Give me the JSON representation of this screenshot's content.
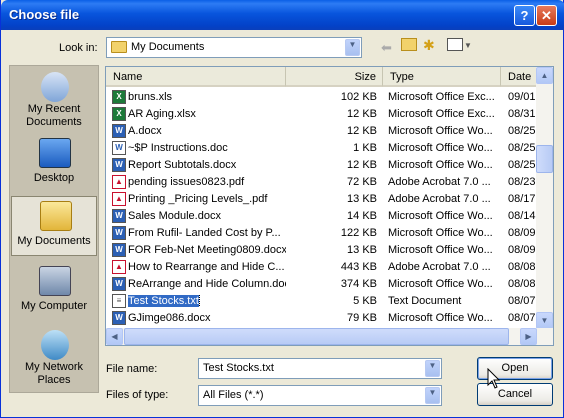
{
  "window": {
    "title": "Choose file",
    "help_label": "?",
    "close_label": "✕"
  },
  "lookin": {
    "label": "Look in:",
    "value": "My Documents"
  },
  "toolbar": {
    "back_icon": "back-arrow-icon",
    "up_icon": "up-folder-icon",
    "new_icon": "new-folder-icon",
    "views_icon": "views-menu-icon"
  },
  "places": [
    {
      "label": "My Recent Documents",
      "icon": "recent-documents-icon"
    },
    {
      "label": "Desktop",
      "icon": "desktop-icon"
    },
    {
      "label": "My Documents",
      "icon": "my-documents-icon"
    },
    {
      "label": "My Computer",
      "icon": "my-computer-icon"
    },
    {
      "label": "My Network Places",
      "icon": "network-places-icon"
    }
  ],
  "columns": [
    "Name",
    "Size",
    "Type",
    "Date"
  ],
  "files": [
    {
      "name": "bruns.xls",
      "size": "102 KB",
      "type": "Microsoft Office Exc...",
      "date": "09/01",
      "kind": "excel"
    },
    {
      "name": "AR Aging.xlsx",
      "size": "12 KB",
      "type": "Microsoft Office Exc...",
      "date": "08/31",
      "kind": "excel"
    },
    {
      "name": "A.docx",
      "size": "12 KB",
      "type": "Microsoft Office Wo...",
      "date": "08/25",
      "kind": "word"
    },
    {
      "name": "~$P Instructions.doc",
      "size": "1 KB",
      "type": "Microsoft Office Wo...",
      "date": "08/25",
      "kind": "doc-temp"
    },
    {
      "name": "Report Subtotals.docx",
      "size": "12 KB",
      "type": "Microsoft Office Wo...",
      "date": "08/25",
      "kind": "word"
    },
    {
      "name": "pending issues0823.pdf",
      "size": "72 KB",
      "type": "Adobe Acrobat 7.0 ...",
      "date": "08/23",
      "kind": "pdf"
    },
    {
      "name": "Printing _Pricing Levels_.pdf",
      "size": "13 KB",
      "type": "Adobe Acrobat 7.0 ...",
      "date": "08/17",
      "kind": "pdf"
    },
    {
      "name": "Sales Module.docx",
      "size": "14 KB",
      "type": "Microsoft Office Wo...",
      "date": "08/14",
      "kind": "word"
    },
    {
      "name": "From Rufil- Landed Cost by P...",
      "size": "122 KB",
      "type": "Microsoft Office Wo...",
      "date": "08/09",
      "kind": "word"
    },
    {
      "name": "FOR Feb-Net Meeting0809.docx",
      "size": "13 KB",
      "type": "Microsoft Office Wo...",
      "date": "08/09",
      "kind": "word"
    },
    {
      "name": "How to Rearrange and Hide C...",
      "size": "443 KB",
      "type": "Adobe Acrobat 7.0 ...",
      "date": "08/08",
      "kind": "pdf"
    },
    {
      "name": "ReArrange and Hide Column.doc",
      "size": "374 KB",
      "type": "Microsoft Office Wo...",
      "date": "08/08",
      "kind": "word"
    },
    {
      "name": "Test Stocks.txt",
      "size": "5 KB",
      "type": "Text Document",
      "date": "08/07",
      "kind": "text",
      "selected": true
    },
    {
      "name": "GJimge086.docx",
      "size": "79 KB",
      "type": "Microsoft Office Wo...",
      "date": "08/07",
      "kind": "word"
    }
  ],
  "filename": {
    "label": "File name:",
    "value": "Test Stocks.txt"
  },
  "filetype": {
    "label": "Files of type:",
    "value": "All Files (*.*)"
  },
  "buttons": {
    "open": "Open",
    "cancel": "Cancel"
  },
  "colors": {
    "titlebar": "#0855dd",
    "selection": "#316ac5",
    "dialog_bg": "#ece9d8"
  }
}
